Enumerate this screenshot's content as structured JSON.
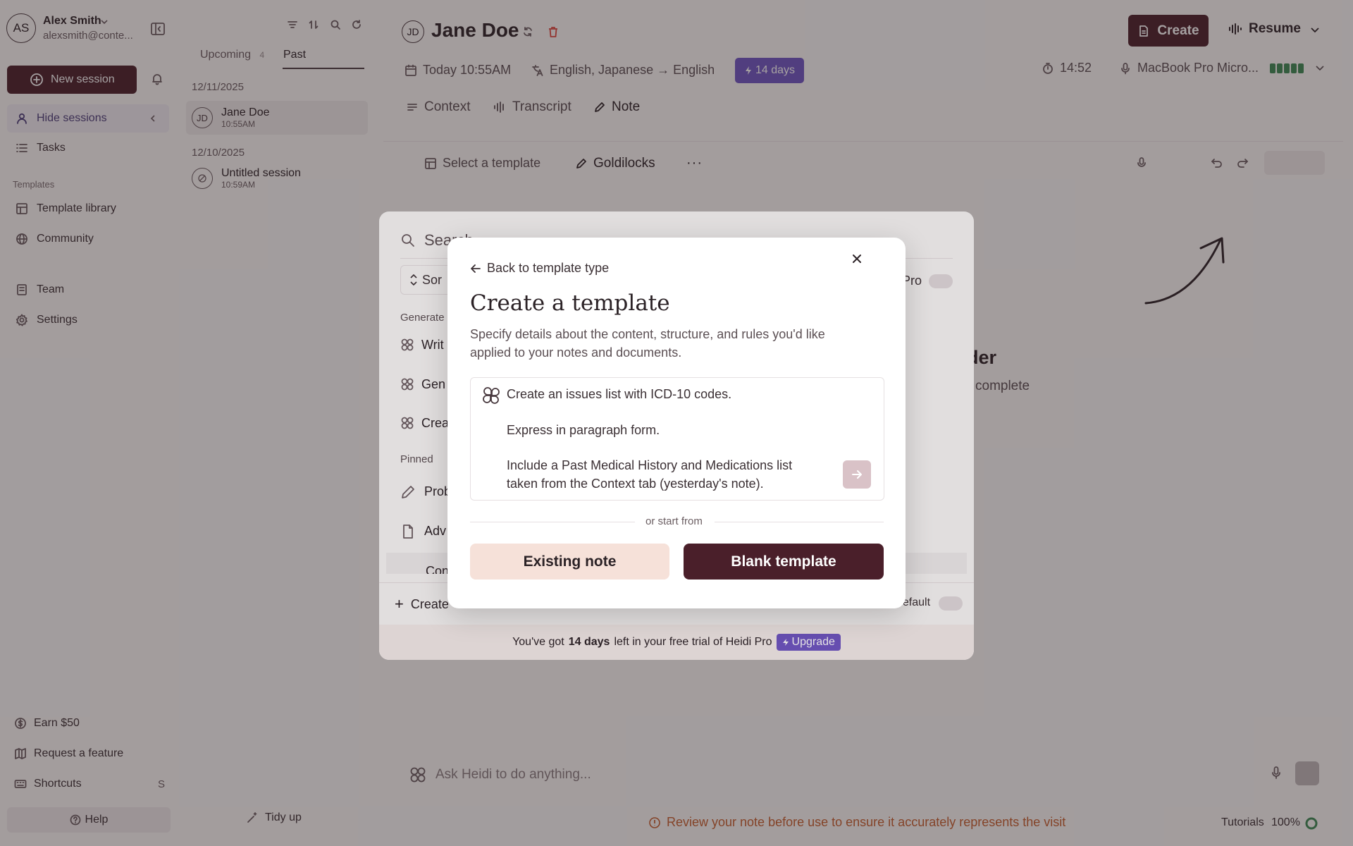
{
  "user": {
    "initials": "AS",
    "name": "Alex Smith",
    "email": "alexsmith@conte..."
  },
  "sidebar": {
    "new_session": "New session",
    "hide_sessions": "Hide sessions",
    "tasks": "Tasks",
    "templates_heading": "Templates",
    "template_library": "Template library",
    "community": "Community",
    "team": "Team",
    "settings": "Settings",
    "earn": "Earn $50",
    "request_feature": "Request a feature",
    "shortcuts": "Shortcuts",
    "shortcuts_key": "S",
    "help": "Help"
  },
  "sessions": {
    "tabs": [
      {
        "label": "Upcoming",
        "count": "4"
      },
      {
        "label": "Past"
      }
    ],
    "groups": [
      {
        "date": "12/11/2025",
        "items": [
          {
            "initials": "JD",
            "name": "Jane Doe",
            "time": "10:55AM"
          }
        ]
      },
      {
        "date": "12/10/2025",
        "items": [
          {
            "initials": "",
            "name": "Untitled session",
            "time": "10:59AM"
          }
        ]
      }
    ],
    "tidy_up": "Tidy up"
  },
  "main": {
    "patient_initials": "JD",
    "patient_name": "Jane Doe",
    "create_label": "Create",
    "resume_label": "Resume",
    "date": "Today 10:55AM",
    "languages": "English, Japanese → English",
    "trial_badge": "14 days",
    "timer": "14:52",
    "mic": "MacBook Pro Micro...",
    "tabs": [
      "Context",
      "Transcript",
      "Note"
    ],
    "select_template": "Select a template",
    "template_name": "Goldilocks",
    "bg_heading_fragment": "der",
    "bg_text_fragment": "complete",
    "ask_placeholder": "Ask Heidi to do anything...",
    "warning": "Review your note before use to ensure it accurately represents the visit",
    "tutorials": "Tutorials",
    "zoom": "100%"
  },
  "picker": {
    "search_placeholder": "Search",
    "sort_label": "Sor",
    "pro_label": "Pro",
    "generate_heading": "Generate",
    "generate_items": [
      "Writ",
      "Gen",
      "Crea"
    ],
    "pinned_heading": "Pinned",
    "pinned_items": [
      "Prob",
      "Adv",
      "Con"
    ],
    "create_label": "Create",
    "default_label": "default",
    "trial_prefix": "You've got",
    "trial_days": "14 days",
    "trial_suffix": "left in your free trial of Heidi Pro",
    "upgrade": "Upgrade"
  },
  "modal": {
    "back": "Back to template type",
    "title": "Create a template",
    "description": "Specify details about the content, structure, and rules you'd like applied to your notes and documents.",
    "prompt_lines": [
      "Create an issues list with ICD-10 codes.",
      "Express in paragraph form.",
      "Include a Past Medical History and Medications list",
      "taken from the Context tab (yesterday's note)."
    ],
    "or_start_from": "or start from",
    "existing_note": "Existing note",
    "blank_template": "Blank template"
  }
}
